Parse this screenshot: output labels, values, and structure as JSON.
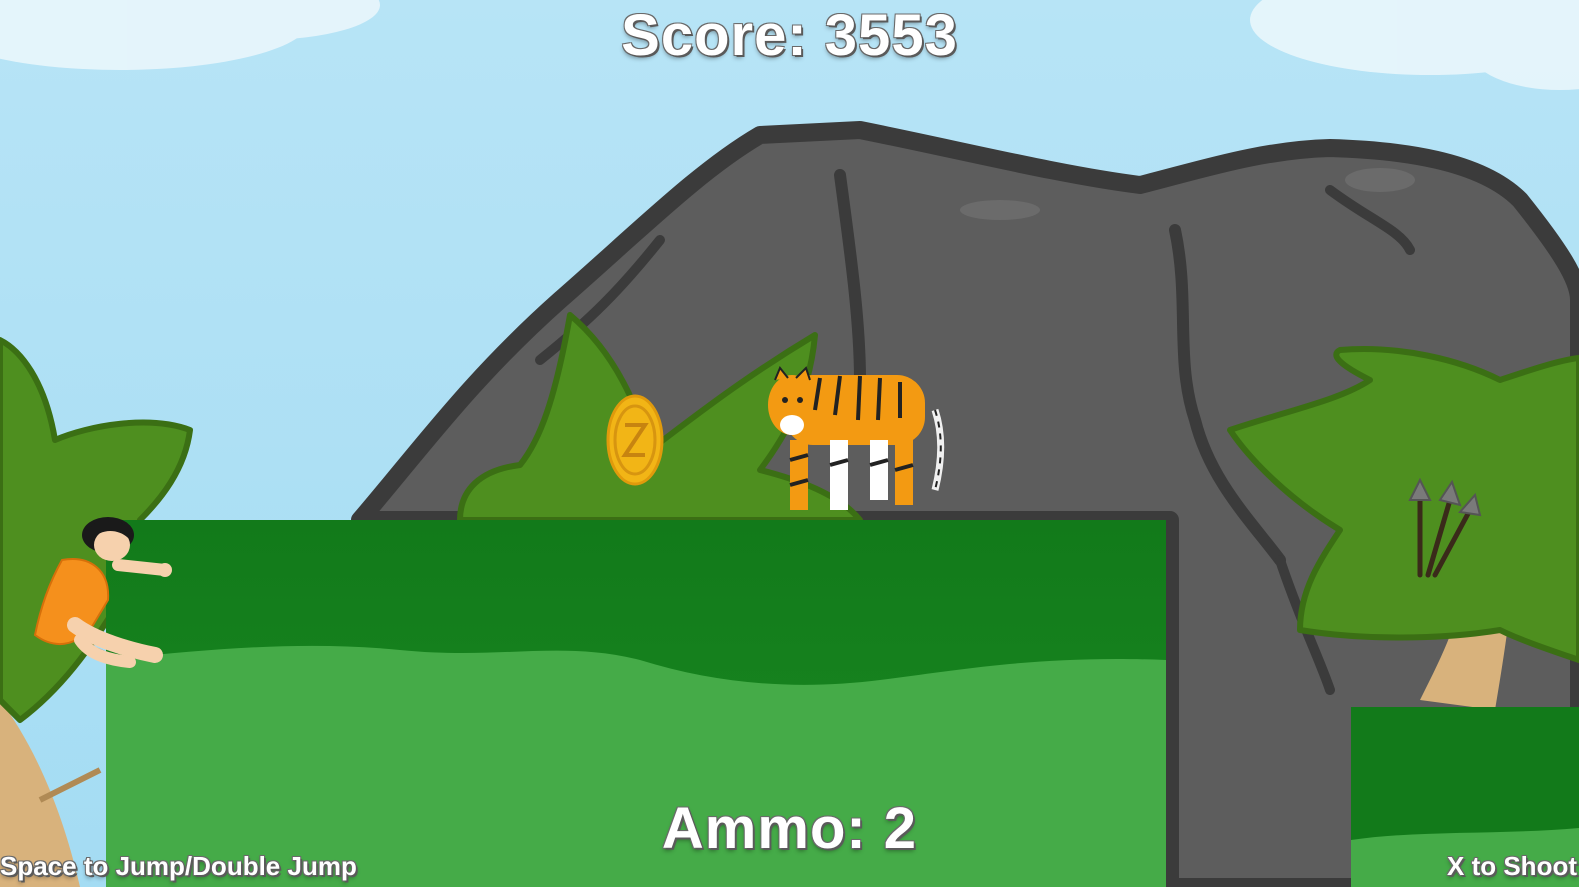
{
  "hud": {
    "score_label": "Score: 3553",
    "ammo_label": "Ammo: 2",
    "jump_hint": "Space to Jump/Double Jump",
    "shoot_hint": "X to Shoot"
  },
  "colors": {
    "sky": "#a9def4",
    "rock": "#5a5a5a",
    "rock_outline": "#3a3a3a",
    "platform_dark": "#127a1a",
    "platform_light": "#45ab48",
    "foliage": "#4e8f1f",
    "coin": "#f2b516",
    "tiger": "#f39a12",
    "caveman_tunic": "#f5901c"
  },
  "icons": [
    "coin-icon",
    "tiger-enemy",
    "caveman-player",
    "arrow-ammo-pickup"
  ]
}
